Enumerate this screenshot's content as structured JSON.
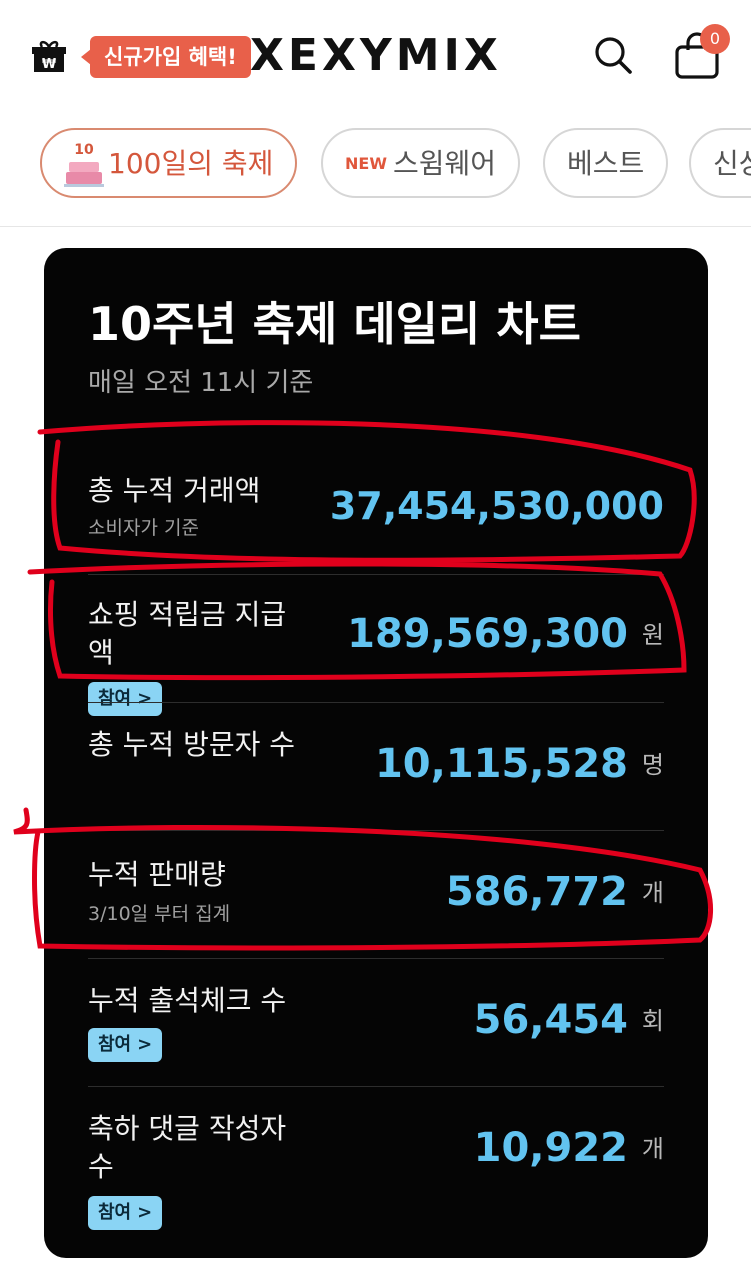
{
  "header": {
    "promo_label": "신규가입 혜택!",
    "logo_text": "XEXYMIX",
    "cart_count": "0",
    "icons": [
      "gift-icon",
      "search-icon",
      "cart-icon"
    ]
  },
  "tabs": [
    {
      "label": "100일의 축제",
      "prefix": "",
      "active": true
    },
    {
      "label": "스윔웨어",
      "prefix": "NEW",
      "active": false
    },
    {
      "label": "베스트",
      "prefix": "",
      "active": false
    },
    {
      "label": "신상",
      "prefix": "",
      "active": false
    }
  ],
  "card": {
    "title": "10주년 축제 데일리 차트",
    "subtitle": "매일 오전 11시 기준",
    "rows": [
      {
        "label": "총 누적 거래액",
        "note": "소비자가 기준",
        "value": "37,454,530,000",
        "unit": "",
        "button": ""
      },
      {
        "label_line1": "쇼핑 적립금 지급",
        "label_line2": "액",
        "value": "189,569,300",
        "unit": "원",
        "button": "참여"
      },
      {
        "label": "총 누적 방문자 수",
        "value": "10,115,528",
        "unit": "명",
        "button": ""
      },
      {
        "label": "누적 판매량",
        "note": "3/10일 부터 집계",
        "value": "586,772",
        "unit": "개",
        "button": ""
      },
      {
        "label": "누적 출석체크 수",
        "value": "56,454",
        "unit": "회",
        "button": "참여"
      },
      {
        "label_line1": "축하 댓글 작성자",
        "label_line2": "수",
        "value": "10,922",
        "unit": "개",
        "button": "참여"
      }
    ]
  },
  "colors": {
    "accent": "#e8604a",
    "value_blue": "#62c3f0",
    "button_blue": "#8ad4f4",
    "annotation_red": "#e0001c"
  }
}
